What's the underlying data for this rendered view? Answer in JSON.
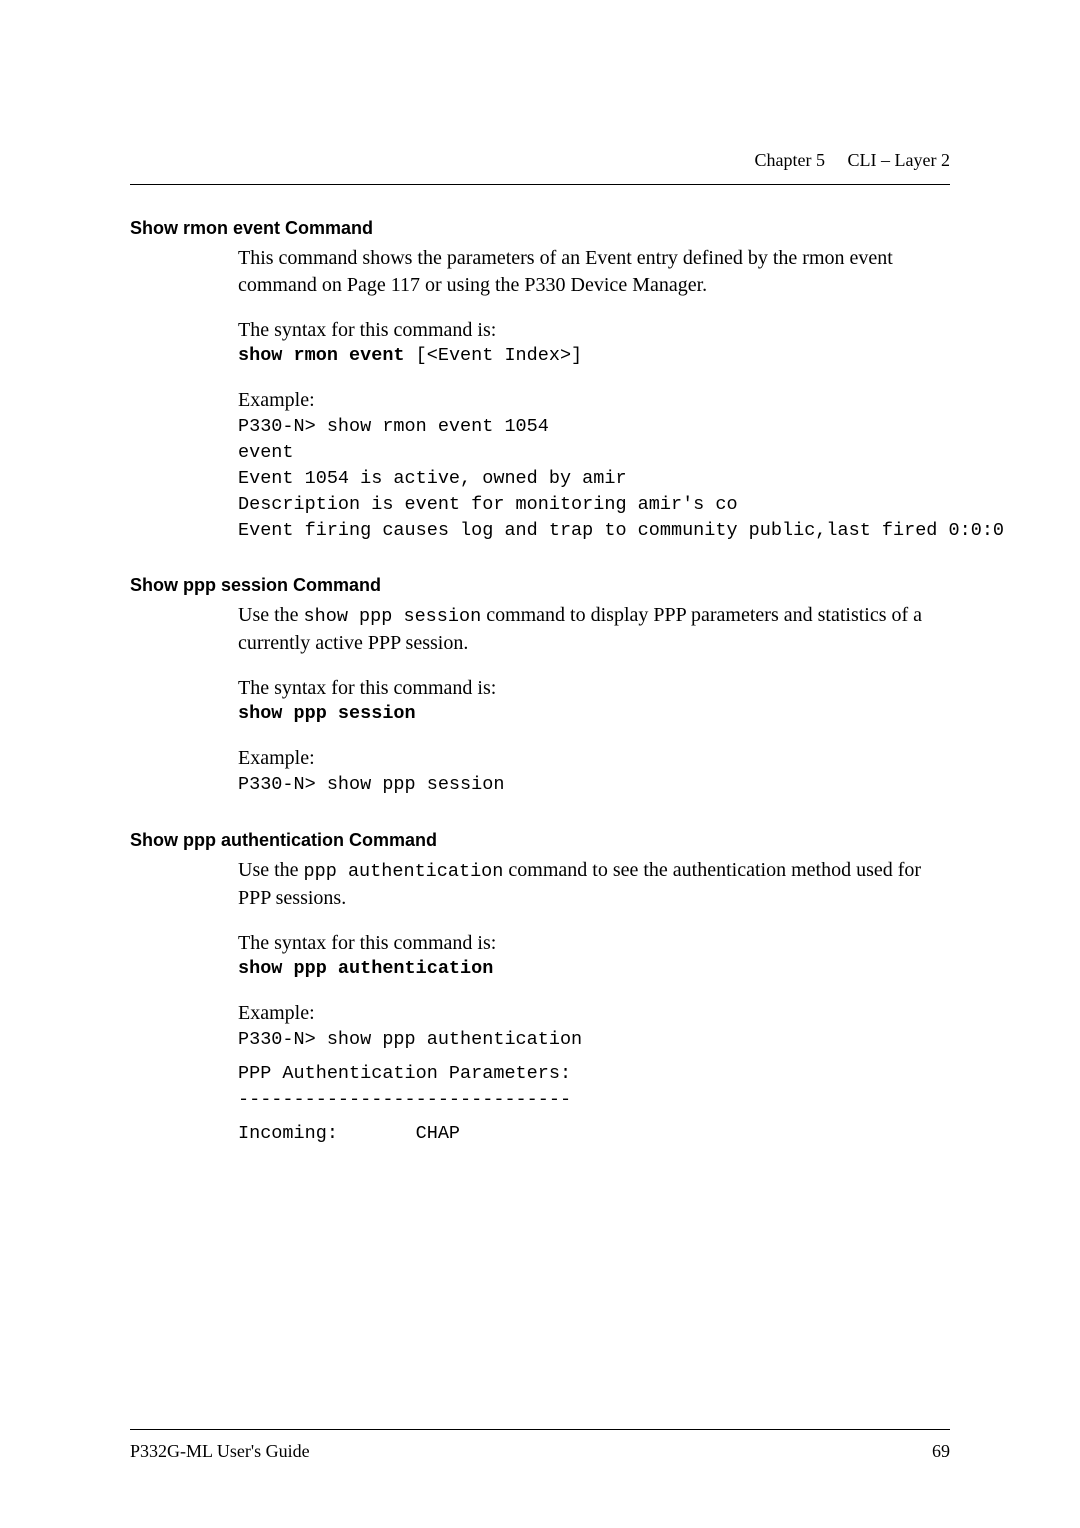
{
  "header": {
    "chapter": "Chapter 5",
    "title": "CLI – Layer 2"
  },
  "sections": [
    {
      "heading": "Show rmon event Command",
      "intro": "This command shows the parameters of an Event entry defined by the rmon event command on Page 117 or using the P330 Device Manager.",
      "syntax_label": "The syntax for this command is:",
      "syntax_cmd_bold": "show rmon event",
      "syntax_cmd_rest": " [<Event Index>]",
      "example_label": "Example:",
      "example_lines": [
        "P330-N> show rmon event 1054",
        "event",
        "",
        "Event 1054 is active, owned by amir",
        "Description is event for monitoring amir's co",
        "Event firing causes log and trap to community public,last fired 0:0:0"
      ]
    },
    {
      "heading": "Show ppp session Command",
      "intro_pre": "Use the ",
      "intro_code": "show ppp session",
      "intro_post": " command to display PPP parameters and statistics of a currently active PPP session.",
      "syntax_label": "The syntax for this command is:",
      "syntax_cmd_bold": "show ppp session",
      "example_label": "Example:",
      "example_lines": [
        "P330-N> show ppp session"
      ]
    },
    {
      "heading": "Show ppp authentication Command",
      "intro_pre": "Use the ",
      "intro_code": "ppp authentication",
      "intro_post": " command to see the authentication method used for PPP sessions.",
      "syntax_label": "The syntax for this command is:",
      "syntax_cmd_bold": "show ppp authentication",
      "example_label": "Example:",
      "example_lines": [
        "P330-N> show ppp authentication",
        "PPP Authentication Parameters:",
        "------------------------------",
        "Incoming:       CHAP"
      ]
    }
  ],
  "footer": {
    "left": "P332G-ML User's Guide",
    "right": "69"
  }
}
